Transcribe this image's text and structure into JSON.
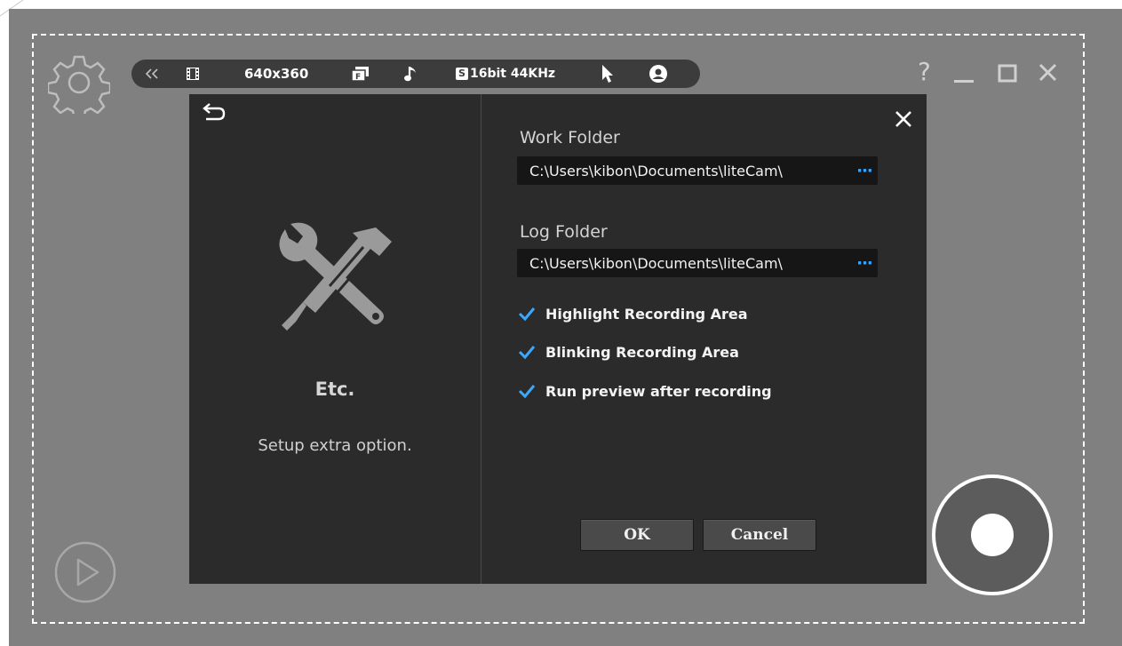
{
  "toolbar": {
    "collapse_icon": "double-chevron-left-icon",
    "video_icon": "film-icon",
    "resolution": "640x360",
    "framerate_icon": "fps-icon",
    "audio_icon": "music-note-icon",
    "audio_badge": "S",
    "audio_format": "16bit 44KHz",
    "cursor_icon": "cursor-icon",
    "webcam_icon": "webcam-icon"
  },
  "window": {
    "help_label": "?",
    "minimize_icon": "minimize-icon",
    "maximize_icon": "maximize-icon",
    "close_icon": "close-icon"
  },
  "dialog": {
    "pane_title": "Etc.",
    "pane_description": "Setup extra option.",
    "work_folder_label": "Work Folder",
    "work_folder_value": "C:\\Users\\kibon\\Documents\\liteCam\\",
    "log_folder_label": "Log Folder",
    "log_folder_value": "C:\\Users\\kibon\\Documents\\liteCam\\",
    "browse_label": "···",
    "options": [
      {
        "label": "Highlight Recording Area",
        "checked": true
      },
      {
        "label": "Blinking Recording Area",
        "checked": true
      },
      {
        "label": "Run preview after recording",
        "checked": true
      }
    ],
    "ok_label": "OK",
    "cancel_label": "Cancel"
  },
  "colors": {
    "accent": "#3aa8ff",
    "dialog_bg": "#2b2b2b",
    "frame_bg": "#808080"
  }
}
